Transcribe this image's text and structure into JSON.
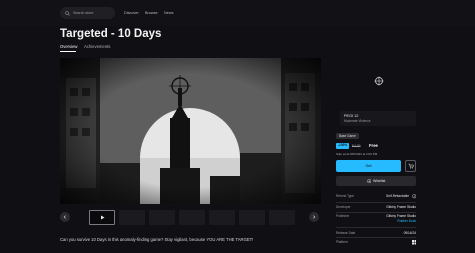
{
  "search": {
    "placeholder": "Search store"
  },
  "nav": {
    "items": [
      "Discover",
      "Browse",
      "News"
    ]
  },
  "game": {
    "title": "Targeted - 10 Days",
    "tabs": [
      "Overview",
      "Achievements"
    ],
    "description": "Can you survive 10 Days in this anomaly-finding game? Stay vigilant, because YOU ARE THE TARGET!"
  },
  "rating": {
    "code": "PEGI 12",
    "descriptor": "Moderate Violence"
  },
  "purchase": {
    "badge": "Base Game",
    "discount": "-100%",
    "original_price": "€4.99",
    "price": "Free",
    "ends": "Sale ends 8/5/2024 at 3:00 PM",
    "get_label": "Get",
    "wishlist_label": "Wishlist"
  },
  "info": {
    "refund_type_label": "Refund Type",
    "refund_type_value": "Self-Refundable",
    "developer_label": "Developer",
    "developer_value": "Glitchy Frame Studio",
    "publisher_label": "Publisher",
    "publisher_value_1": "Glitchy Frame Studio",
    "publisher_value_2": "Rubber Duck",
    "release_label": "Release Date",
    "release_value": "09/14/24",
    "platform_label": "Platform"
  },
  "colors": {
    "accent": "#26bbff",
    "background": "#101014"
  },
  "icons": [
    "search-icon",
    "chevron-left-icon",
    "chevron-right-icon",
    "play-icon",
    "cart-icon",
    "plus-circle-icon",
    "info-icon",
    "windows-icon",
    "game-logo-icon"
  ]
}
